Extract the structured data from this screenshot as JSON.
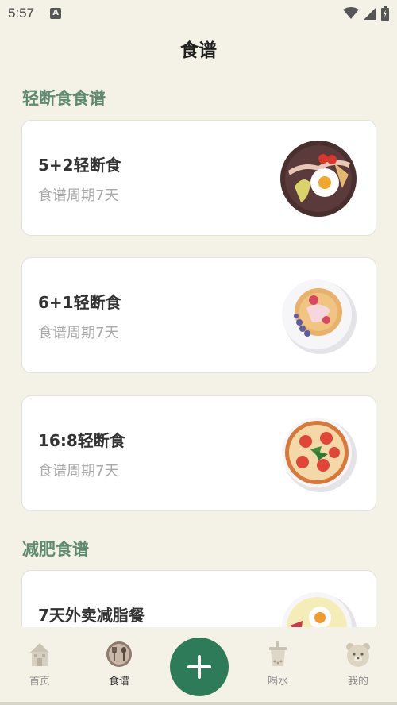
{
  "status": {
    "time": "5:57"
  },
  "header": {
    "title": "食谱"
  },
  "sections": [
    {
      "title": "轻断食食谱"
    },
    {
      "title": "减肥食谱"
    }
  ],
  "cards": [
    {
      "title": "5+2轻断食",
      "subtitle": "食谱周期7天",
      "image_icon": "breakfast-plate-icon"
    },
    {
      "title": "6+1轻断食",
      "subtitle": "食谱周期7天",
      "image_icon": "waffle-plate-icon"
    },
    {
      "title": "16:8轻断食",
      "subtitle": "食谱周期7天",
      "image_icon": "pizza-plate-icon"
    },
    {
      "title": "7天外卖减脂餐",
      "subtitle": "",
      "image_icon": "egg-plate-icon"
    }
  ],
  "tabbar": {
    "items": [
      {
        "label": "首页",
        "icon": "home-icon"
      },
      {
        "label": "食谱",
        "icon": "recipe-icon"
      },
      {
        "label": "喝水",
        "icon": "drink-cup-icon"
      },
      {
        "label": "我的",
        "icon": "bear-profile-icon"
      }
    ],
    "add_icon": "plus-icon"
  },
  "colors": {
    "background": "#f4f1e6",
    "accent_green": "#2d7b58",
    "section_green": "#5e8a72",
    "card_bg": "#ffffff",
    "muted_text": "#a9a9a9"
  }
}
